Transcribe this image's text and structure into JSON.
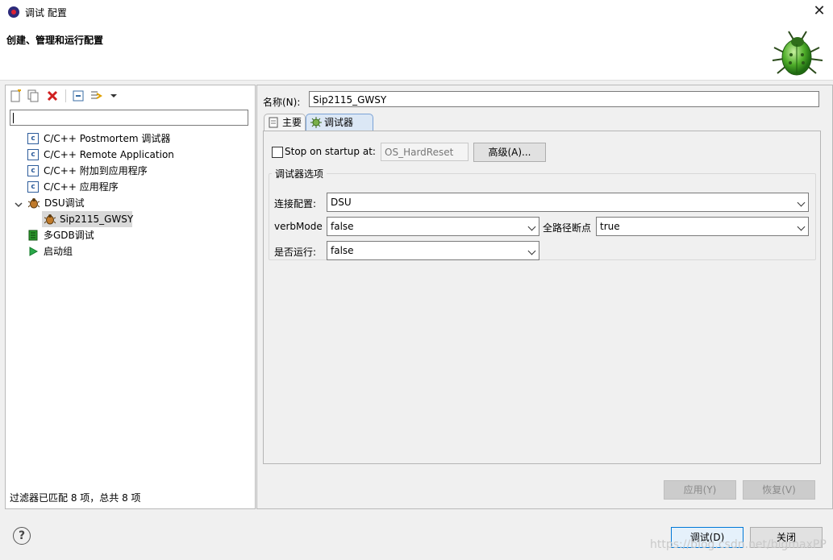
{
  "window": {
    "title": "调试 配置",
    "close_glyph": "✕"
  },
  "header": {
    "title": "创建、管理和运行配置",
    "icon": "bug-icon"
  },
  "left": {
    "tree": [
      {
        "label": "C/C++ Postmortem 调试器",
        "icon": "c-config-icon"
      },
      {
        "label": "C/C++ Remote Application",
        "icon": "c-config-icon"
      },
      {
        "label": "C/C++ 附加到应用程序",
        "icon": "c-config-icon"
      },
      {
        "label": "C/C++ 应用程序",
        "icon": "c-config-icon"
      },
      {
        "label": "DSU调试",
        "icon": "bug-icon",
        "expanded": true
      },
      {
        "label": "Sip2115_GWSY",
        "icon": "bug-icon",
        "selected": true
      },
      {
        "label": "多GDB调试",
        "icon": "multi-gdb-icon"
      },
      {
        "label": "启动组",
        "icon": "launch-group-icon"
      }
    ],
    "status": "过滤器已匹配 8 项，总共 8 项",
    "filter_value": ""
  },
  "right": {
    "name_label": "名称(N):",
    "name_value": "Sip2115_GWSY",
    "tabs": [
      {
        "label": "主要",
        "icon": "page-icon"
      },
      {
        "label": "调试器",
        "icon": "debugger-icon",
        "active": true
      }
    ],
    "stop_on_startup": {
      "label": "Stop on startup at:",
      "checked": false,
      "value": "OS_HardReset"
    },
    "advanced_button": "高级(A)...",
    "group_title": "调试器选项",
    "fields": {
      "connection_label": "连接配置:",
      "connection_value": "DSU",
      "verbmode_label": "verbMode",
      "verbmode_value": "false",
      "breakpoint_label": "全路径断点",
      "breakpoint_value": "true",
      "run_label": "是否运行:",
      "run_value": "false"
    },
    "apply_button": "应用(Y)",
    "revert_button": "恢复(V)"
  },
  "footer": {
    "help_glyph": "?",
    "debug_button": "调试(D)",
    "close_button": "关闭",
    "watermark": "https://blog.csdn.net/bigmaxPP"
  }
}
